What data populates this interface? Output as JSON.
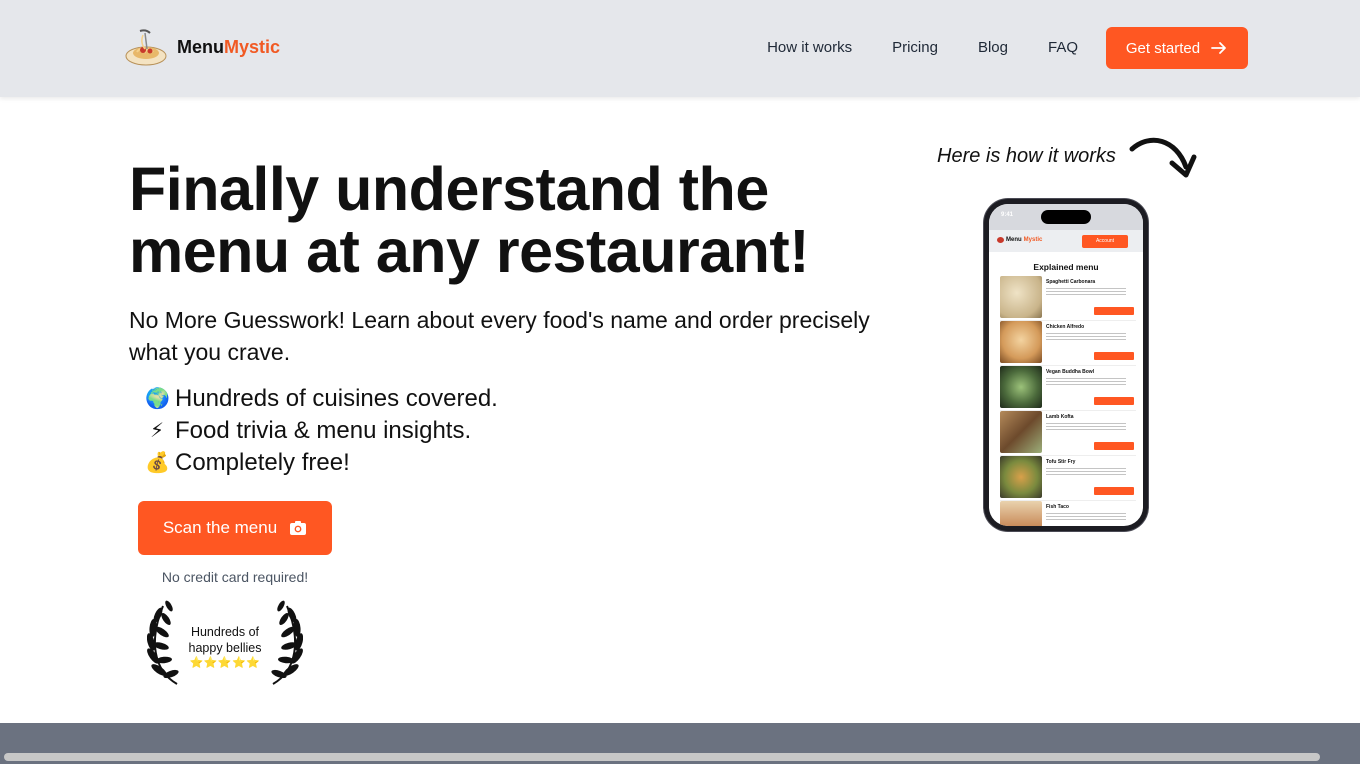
{
  "brand": {
    "name_main": "Menu",
    "name_accent": "Mystic",
    "accent_color": "#f15a24",
    "logo_icon": "spaghetti-bowl-icon"
  },
  "nav": {
    "links": [
      "How it works",
      "Pricing",
      "Blog",
      "FAQ"
    ],
    "cta_label": "Get started",
    "cta_icon": "arrow-right-icon",
    "cta_color": "#ff5722"
  },
  "hero": {
    "title": "Finally understand the menu at any restaurant!",
    "subtitle": "No More Guesswork! Learn about every food's name and order precisely what you crave.",
    "features": [
      {
        "emoji": "🌍",
        "text": "Hundreds of cuisines covered."
      },
      {
        "emoji": "⚡",
        "text": "Food trivia & menu insights."
      },
      {
        "emoji": "💰",
        "text": "Completely free!"
      }
    ],
    "scan_button": "Scan the menu",
    "scan_icon": "camera-icon",
    "no_credit_card": "No credit card required!",
    "badge_line1": "Hundreds of",
    "badge_line2": "happy bellies",
    "badge_stars": "⭐⭐⭐⭐⭐"
  },
  "demo": {
    "label": "Here is how it works",
    "phone": {
      "time": "9:41",
      "app_brand_main": "Menu",
      "app_brand_accent": "Mystic",
      "account_label": "Account",
      "screen_title": "Explained menu",
      "items": [
        {
          "name": "Spaghetti Carbonara",
          "color": "#c9b48a"
        },
        {
          "name": "Chicken Alfredo",
          "color": "#d49a5a"
        },
        {
          "name": "Vegan Buddha Bowl",
          "color": "#4c6b3c"
        },
        {
          "name": "Lamb Kofta",
          "color": "#6d4a2c"
        },
        {
          "name": "Tofu Stir Fry",
          "color": "#7a8a3e"
        },
        {
          "name": "Fish Taco",
          "color": "#c98b5a"
        }
      ]
    }
  }
}
